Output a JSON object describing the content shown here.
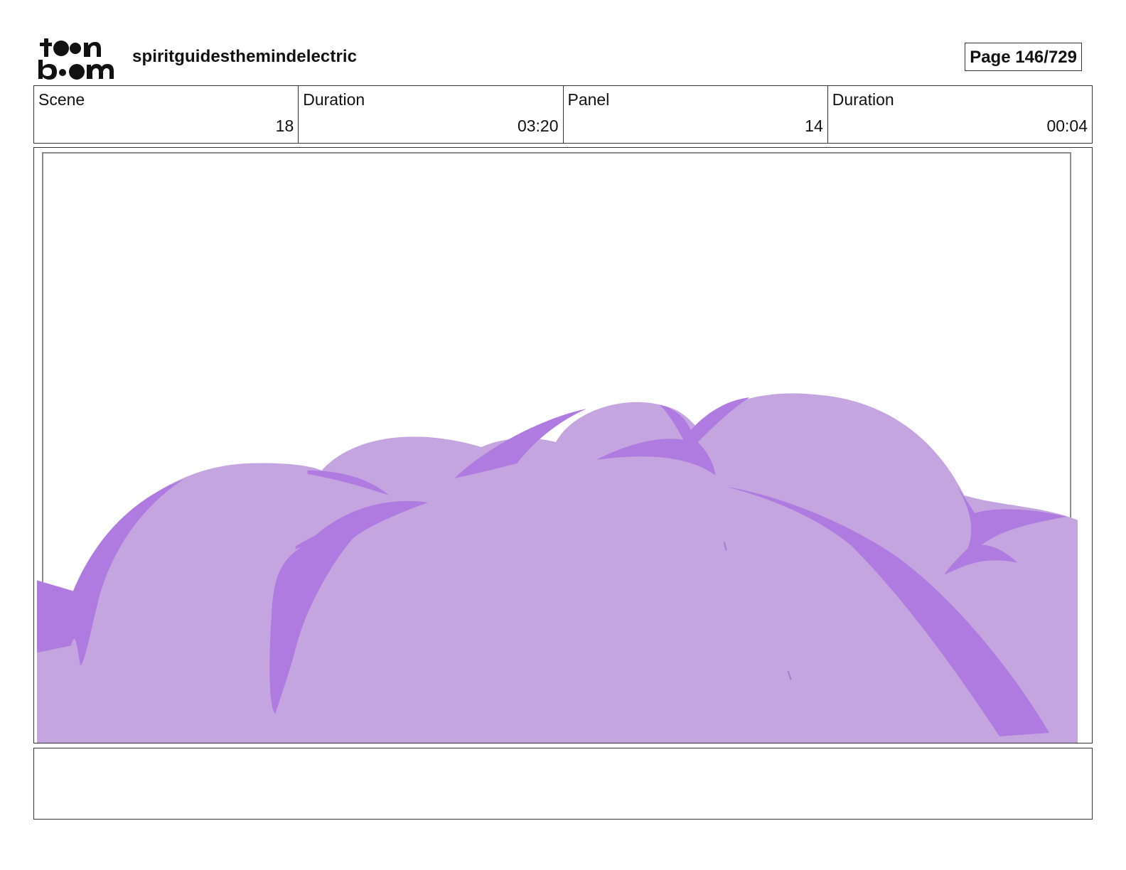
{
  "header": {
    "logo": {
      "icon": "toon-boom-logo",
      "text": "toon boom"
    },
    "project_title": "spiritguidesthemindelectric",
    "page_indicator": "Page 146/729"
  },
  "info": [
    {
      "label": "Scene",
      "value": "18"
    },
    {
      "label": "Duration",
      "value": "03:20"
    },
    {
      "label": "Panel",
      "value": "14"
    },
    {
      "label": "Duration",
      "value": "00:04"
    }
  ],
  "panel": {
    "description_icon": "purple-cloud-drawing",
    "colors": {
      "cloud_fill": "#c4a5e0",
      "cloud_shadow": "#b07be0",
      "safe_frame": "#8a8a8a"
    }
  },
  "caption": {
    "text": ""
  }
}
